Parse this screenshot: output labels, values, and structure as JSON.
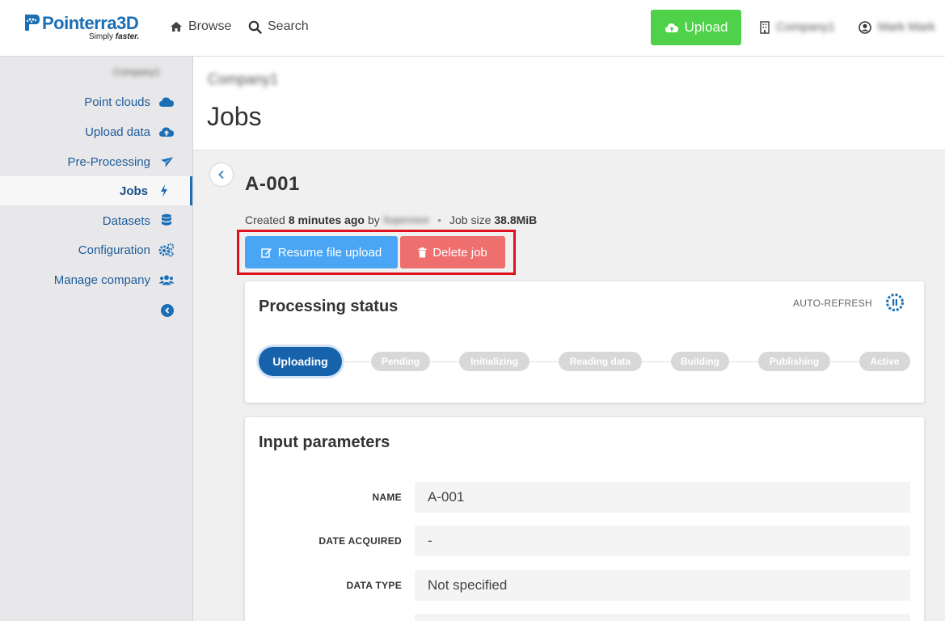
{
  "brand": {
    "name": "Pointerra3D",
    "tagline_prefix": "Simply",
    "tagline_emphasis": "faster."
  },
  "topnav": {
    "browse": "Browse",
    "search": "Search",
    "upload": "Upload",
    "company": "Company1",
    "user": "Mark Mark"
  },
  "sidebar": {
    "company": "Company1",
    "items": [
      {
        "label": "Point clouds",
        "icon": "cloud-icon"
      },
      {
        "label": "Upload data",
        "icon": "cloud-upload-icon"
      },
      {
        "label": "Pre-Processing",
        "icon": "plane-icon"
      },
      {
        "label": "Jobs",
        "icon": "bolt-icon",
        "active": true
      },
      {
        "label": "Datasets",
        "icon": "database-icon"
      },
      {
        "label": "Configuration",
        "icon": "cogs-icon"
      },
      {
        "label": "Manage company",
        "icon": "users-icon"
      }
    ]
  },
  "header": {
    "company": "Company1",
    "title": "Jobs"
  },
  "job": {
    "title": "A-001",
    "created_prefix": "Created",
    "created_ago": "8 minutes ago",
    "by": "by",
    "user": "Supervisor",
    "size_label": "Job size",
    "size_value": "38.8MiB",
    "resume_label": "Resume file upload",
    "delete_label": "Delete job"
  },
  "processing": {
    "title": "Processing status",
    "auto_refresh": "AUTO-REFRESH",
    "steps": [
      "Uploading",
      "Pending",
      "Initializing",
      "Reading data",
      "Building",
      "Publishing",
      "Active"
    ],
    "current_step": "Uploading"
  },
  "params": {
    "title": "Input parameters",
    "rows": [
      {
        "label": "NAME",
        "value": "A-001"
      },
      {
        "label": "DATE ACQUIRED",
        "value": "-"
      },
      {
        "label": "DATA TYPE",
        "value": "Not specified"
      }
    ]
  },
  "colors": {
    "brand_blue": "#1a6fb5",
    "upload_green": "#4fd14a",
    "resume_blue": "#4aa6f4",
    "delete_red": "#ef6e6e",
    "highlight_red": "#e0101c",
    "active_step": "#1662ab"
  }
}
